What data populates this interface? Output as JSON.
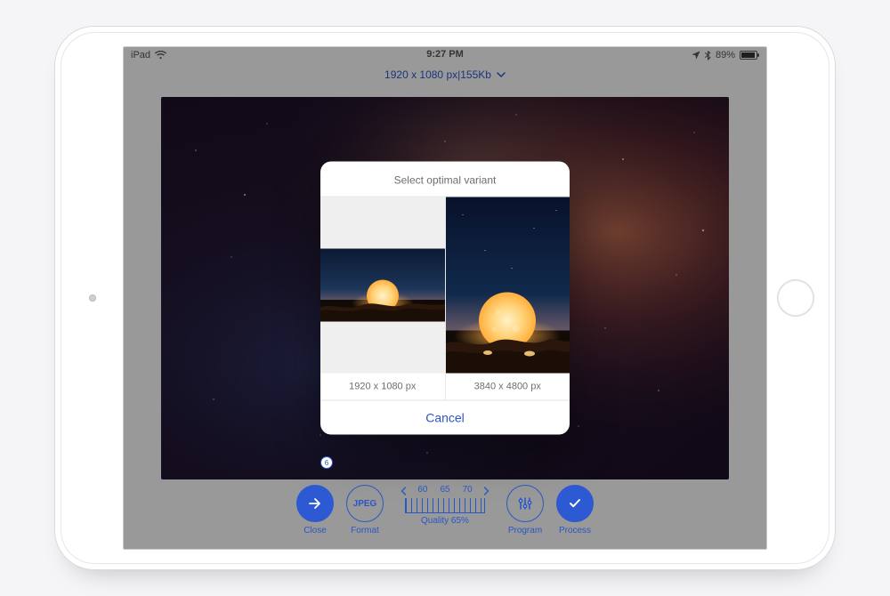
{
  "status_bar": {
    "carrier": "iPad",
    "time": "9:27 PM",
    "battery_text": "89%"
  },
  "header": {
    "dimensions": "1920 x 1080 px",
    "separator": " | ",
    "filesize": "155Kb"
  },
  "modal": {
    "title": "Select optimal variant",
    "variants": [
      {
        "label": "1920 x 1080 px"
      },
      {
        "label": "3840 x 4800 px"
      }
    ],
    "cancel": "Cancel"
  },
  "toolbar": {
    "close": {
      "label": "Close",
      "badge": "6"
    },
    "format": {
      "label": "Format",
      "value": "JPEG"
    },
    "quality": {
      "label": "Quality 65%",
      "ticks": [
        "60",
        "65",
        "70"
      ]
    },
    "program": {
      "label": "Program"
    },
    "process": {
      "label": "Process"
    }
  },
  "icons": {
    "wifi": "wifi-icon",
    "location": "location-icon",
    "bluetooth": "bluetooth-icon",
    "battery": "battery-icon",
    "chevron_down": "chevron-down-icon",
    "arrow_right": "arrow-right-icon",
    "sliders": "sliders-icon",
    "check": "check-icon"
  },
  "colors": {
    "accent": "#2a56c6",
    "accent_fill": "#2d59d3"
  }
}
